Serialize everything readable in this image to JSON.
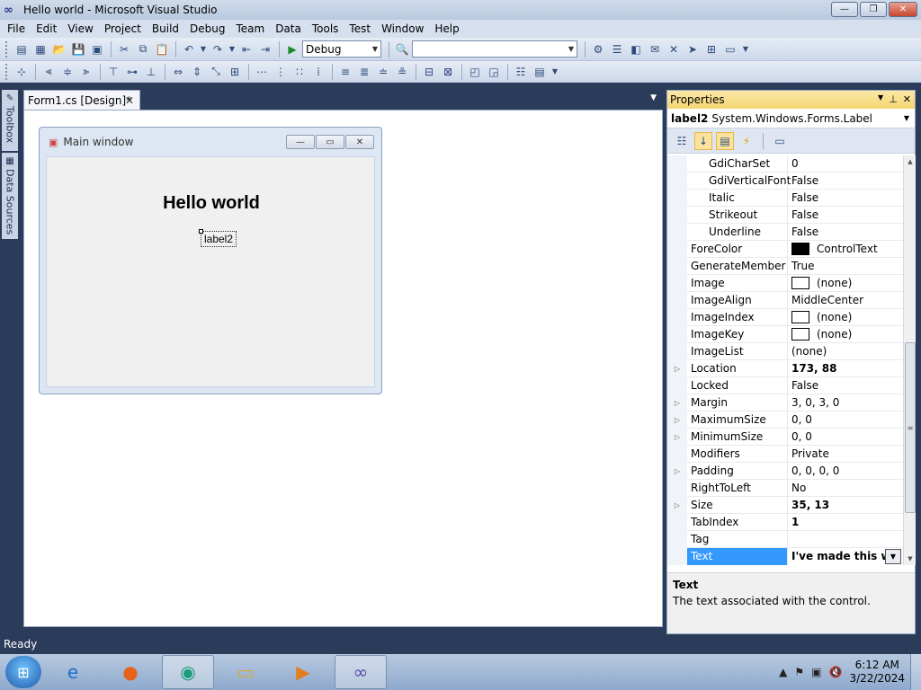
{
  "window": {
    "title": "Hello world - Microsoft Visual Studio",
    "minimize": "—",
    "restore": "❐",
    "close": "✕"
  },
  "menu": [
    "File",
    "Edit",
    "View",
    "Project",
    "Build",
    "Debug",
    "Team",
    "Data",
    "Tools",
    "Test",
    "Window",
    "Help"
  ],
  "toolbar": {
    "config_value": "Debug",
    "search_value": ""
  },
  "sidetabs": {
    "toolbox": "Toolbox",
    "datasources": "Data Sources"
  },
  "document": {
    "tab_label": "Form1.cs [Design]*",
    "tab_close": "✕"
  },
  "form": {
    "caption": "Main window",
    "hello_label": "Hello world",
    "label2": "label2"
  },
  "properties": {
    "title": "Properties",
    "object_name": "label2",
    "object_type": "System.Windows.Forms.Label",
    "rows": [
      {
        "name": "GdiCharSet",
        "value": "0"
      },
      {
        "name": "GdiVerticalFont",
        "value": "False"
      },
      {
        "name": "Italic",
        "value": "False"
      },
      {
        "name": "Strikeout",
        "value": "False"
      },
      {
        "name": "Underline",
        "value": "False"
      },
      {
        "name": "ForeColor",
        "value": "ControlText"
      },
      {
        "name": "GenerateMember",
        "value": "True"
      },
      {
        "name": "Image",
        "value": "(none)"
      },
      {
        "name": "ImageAlign",
        "value": "MiddleCenter"
      },
      {
        "name": "ImageIndex",
        "value": "(none)"
      },
      {
        "name": "ImageKey",
        "value": "(none)"
      },
      {
        "name": "ImageList",
        "value": "(none)"
      },
      {
        "name": "Location",
        "value": "173, 88"
      },
      {
        "name": "Locked",
        "value": "False"
      },
      {
        "name": "Margin",
        "value": "3, 0, 3, 0"
      },
      {
        "name": "MaximumSize",
        "value": "0, 0"
      },
      {
        "name": "MinimumSize",
        "value": "0, 0"
      },
      {
        "name": "Modifiers",
        "value": "Private"
      },
      {
        "name": "Padding",
        "value": "0, 0, 0, 0"
      },
      {
        "name": "RightToLeft",
        "value": "No"
      },
      {
        "name": "Size",
        "value": "35, 13"
      },
      {
        "name": "TabIndex",
        "value": "1"
      },
      {
        "name": "Tag",
        "value": ""
      },
      {
        "name": "Text",
        "value": "I've made this w"
      }
    ],
    "description_title": "Text",
    "description_text": "The text associated with the control."
  },
  "status": {
    "text": "Ready"
  },
  "taskbar": {
    "time": "6:12 AM",
    "date": "3/22/2024"
  },
  "colors": {
    "accent": "#3399ff",
    "properties_header": "#f5d572",
    "ide_background": "#2b3b5a"
  }
}
